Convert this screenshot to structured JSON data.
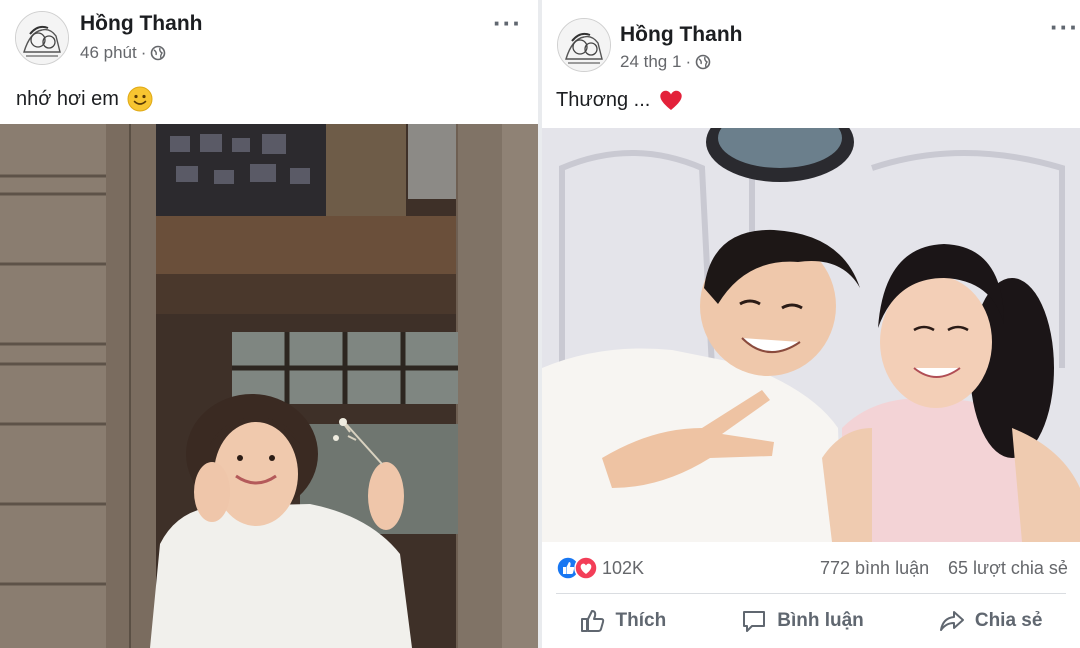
{
  "left_post": {
    "author": "Hồng Thanh",
    "time": "46 phút",
    "separator": "·",
    "privacy_icon": "globe-icon",
    "status_text": "nhớ hơi em",
    "status_emoji": "slightly-smiling-face-icon"
  },
  "right_post": {
    "author": "Hồng Thanh",
    "time": "24 thg 1",
    "separator": "·",
    "privacy_icon": "globe-icon",
    "status_text": "Thương ...",
    "status_emoji": "red-heart-icon",
    "reactions": {
      "count": "102K",
      "comments": "772 bình luận",
      "shares": "65 lượt chia sẻ"
    },
    "actions": {
      "like": "Thích",
      "comment": "Bình luận",
      "share": "Chia sẻ"
    }
  },
  "colors": {
    "like_blue": "#1877f2",
    "love_red": "#f33e58",
    "text_gray": "#65676b"
  }
}
